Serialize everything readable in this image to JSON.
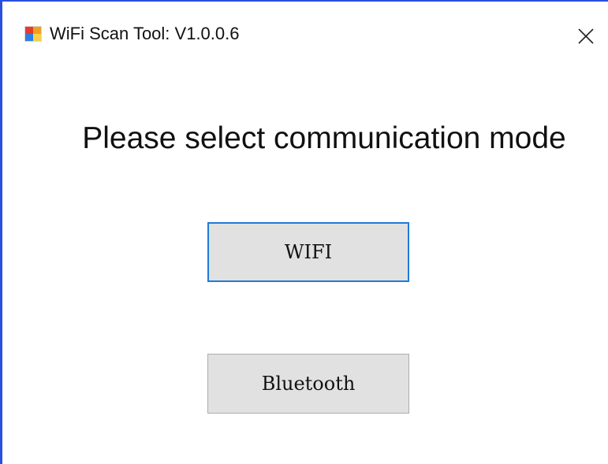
{
  "window": {
    "title": "WiFi Scan Tool:  V1.0.0.6",
    "app_icon": "app-window-icon",
    "close_icon": "close-icon"
  },
  "main": {
    "heading": "Please select communication mode",
    "buttons": [
      {
        "label": "WIFI",
        "focused": true
      },
      {
        "label": "Bluetooth",
        "focused": false
      }
    ]
  },
  "colors": {
    "window_border": "#2a4ee0",
    "focus_border": "#1f7ad8",
    "button_face": "#e1e1e1"
  }
}
